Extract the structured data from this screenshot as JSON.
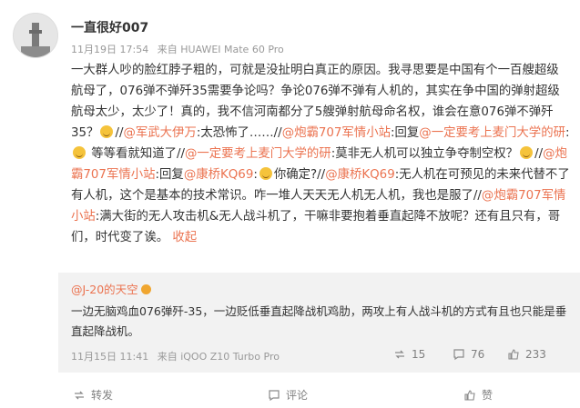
{
  "post": {
    "username": "一直很好007",
    "date": "11月19日 17:54",
    "source": "来自 HUAWEI Mate 60 Pro",
    "segments": [
      {
        "t": "text",
        "v": "一大群人吵的脸红脖子粗的，可就是没扯明白真正的原因。我寻思要是中国有个一百艘超级航母了，076弹不弹歼35需要争论吗？争论076弹不弹有人机的，其实在争中国的弹射超级航母太少，太少了！真的，我不信河南都分了5艘弹射航母命名权，谁会在意076弹不弹歼35？"
      },
      {
        "t": "emoji",
        "v": "惊讶"
      },
      {
        "t": "text",
        "v": "//"
      },
      {
        "t": "mention",
        "v": "@军武大伊万"
      },
      {
        "t": "text",
        "v": ":太恐怖了……//"
      },
      {
        "t": "mention",
        "v": "@炮霸707军情小站"
      },
      {
        "t": "text",
        "v": ":回复"
      },
      {
        "t": "mention",
        "v": "@一定要考上麦门大学的研"
      },
      {
        "t": "text",
        "v": ":"
      },
      {
        "t": "emoji",
        "v": "思考"
      },
      {
        "t": "text",
        "v": " 等等看就知道了//"
      },
      {
        "t": "mention",
        "v": "@一定要考上麦门大学的研"
      },
      {
        "t": "text",
        "v": ":莫非无人机可以独立争夺制空权？"
      },
      {
        "t": "emoji",
        "v": "坏笑"
      },
      {
        "t": "text",
        "v": "//"
      },
      {
        "t": "mention",
        "v": "@炮霸707军情小站"
      },
      {
        "t": "text",
        "v": ":回复"
      },
      {
        "t": "mention",
        "v": "@康桥KQ69"
      },
      {
        "t": "text",
        "v": ":"
      },
      {
        "t": "emoji",
        "v": "笑哭"
      },
      {
        "t": "text",
        "v": "你确定?//"
      },
      {
        "t": "mention",
        "v": "@康桥KQ69"
      },
      {
        "t": "text",
        "v": ":无人机在可预见的未来代替不了有人机，这个是基本的技术常识。咋一堆人天天无人机无人机，我也是服了//"
      },
      {
        "t": "mention",
        "v": "@炮霸707军情小站"
      },
      {
        "t": "text",
        "v": ":满大街的无人攻击机&无人战斗机了，干嘛非要抱着垂直起降不放呢？还有且只有，哥们，时代变了诶。"
      }
    ],
    "collapse_label": "收起"
  },
  "repost": {
    "user": "@J-20的天空",
    "text": "一边无脑鸡血076弹歼-35，一边贬低垂直起降战机鸡肋，两攻上有人战斗机的方式有且也只能是垂直起降战机。",
    "date": "11月15日 11:41",
    "source": "来自 iQOO Z10 Turbo Pro",
    "reposts": "15",
    "comments": "76",
    "likes": "233"
  },
  "actions": {
    "repost": "转发",
    "comment": "评论",
    "like": "赞"
  }
}
